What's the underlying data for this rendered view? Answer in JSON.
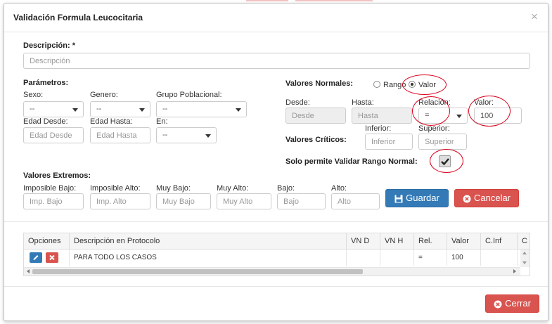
{
  "modal": {
    "title": "Validación Formula Leucocitaria",
    "close_icon": "×"
  },
  "descripcion": {
    "label": "Descripción:",
    "required_mark": "*",
    "placeholder": "Descripción"
  },
  "parametros": {
    "label": "Parámetros:",
    "sexo": {
      "label": "Sexo:",
      "value": "--"
    },
    "genero": {
      "label": "Genero:",
      "value": "--"
    },
    "grupo": {
      "label": "Grupo Poblacional:",
      "value": "--"
    },
    "edad_desde": {
      "label": "Edad Desde:",
      "placeholder": "Edad Desde"
    },
    "edad_hasta": {
      "label": "Edad Hasta:",
      "placeholder": "Edad Hasta"
    },
    "en": {
      "label": "En:",
      "value": "--"
    }
  },
  "valores_normales": {
    "label": "Valores Normales:",
    "radio_rango": "Rango",
    "radio_valor": "Valor",
    "selected": "Valor",
    "desde": {
      "label": "Desde:",
      "placeholder": "Desde"
    },
    "hasta": {
      "label": "Hasta:",
      "placeholder": "Hasta"
    },
    "relacion": {
      "label": "Relación:",
      "value": "="
    },
    "valor": {
      "label": "Valor:",
      "value": "100"
    }
  },
  "valores_criticos": {
    "label": "Valores Críticos:",
    "inferior": {
      "label": "Inferior:",
      "placeholder": "Inferior"
    },
    "superior": {
      "label": "Superior:",
      "placeholder": "Superior"
    }
  },
  "solo_rango": {
    "label": "Solo permite Validar Rango Normal:",
    "checked": true
  },
  "valores_extremos": {
    "label": "Valores Extremos:",
    "imp_bajo": {
      "label": "Imposible Bajo:",
      "placeholder": "Imp. Bajo"
    },
    "imp_alto": {
      "label": "Imposible Alto:",
      "placeholder": "Imp. Alto"
    },
    "muy_bajo": {
      "label": "Muy Bajo:",
      "placeholder": "Muy Bajo"
    },
    "muy_alto": {
      "label": "Muy Alto:",
      "placeholder": "Muy Alto"
    },
    "bajo": {
      "label": "Bajo:",
      "placeholder": "Bajo"
    },
    "alto": {
      "label": "Alto:",
      "placeholder": "Alto"
    }
  },
  "buttons": {
    "guardar": "Guardar",
    "cancelar": "Cancelar",
    "cerrar": "Cerrar"
  },
  "colors": {
    "primary": "#337ab7",
    "danger": "#d9534f",
    "annotation": "#d9001b"
  },
  "icons": {
    "edit": "pencil-icon",
    "delete": "times-icon",
    "save": "floppy-disk-icon",
    "cancel": "times-circle-icon"
  },
  "table": {
    "headers": [
      "Opciones",
      "Descripción en Protocolo",
      "VN D",
      "VN H",
      "Rel.",
      "Valor",
      "C.Inf",
      "C"
    ],
    "rows": [
      {
        "descripcion": "PARA TODO LOS CASOS",
        "vn_d": "",
        "vn_h": "",
        "rel": "=",
        "valor": "100",
        "c_inf": ""
      }
    ]
  }
}
